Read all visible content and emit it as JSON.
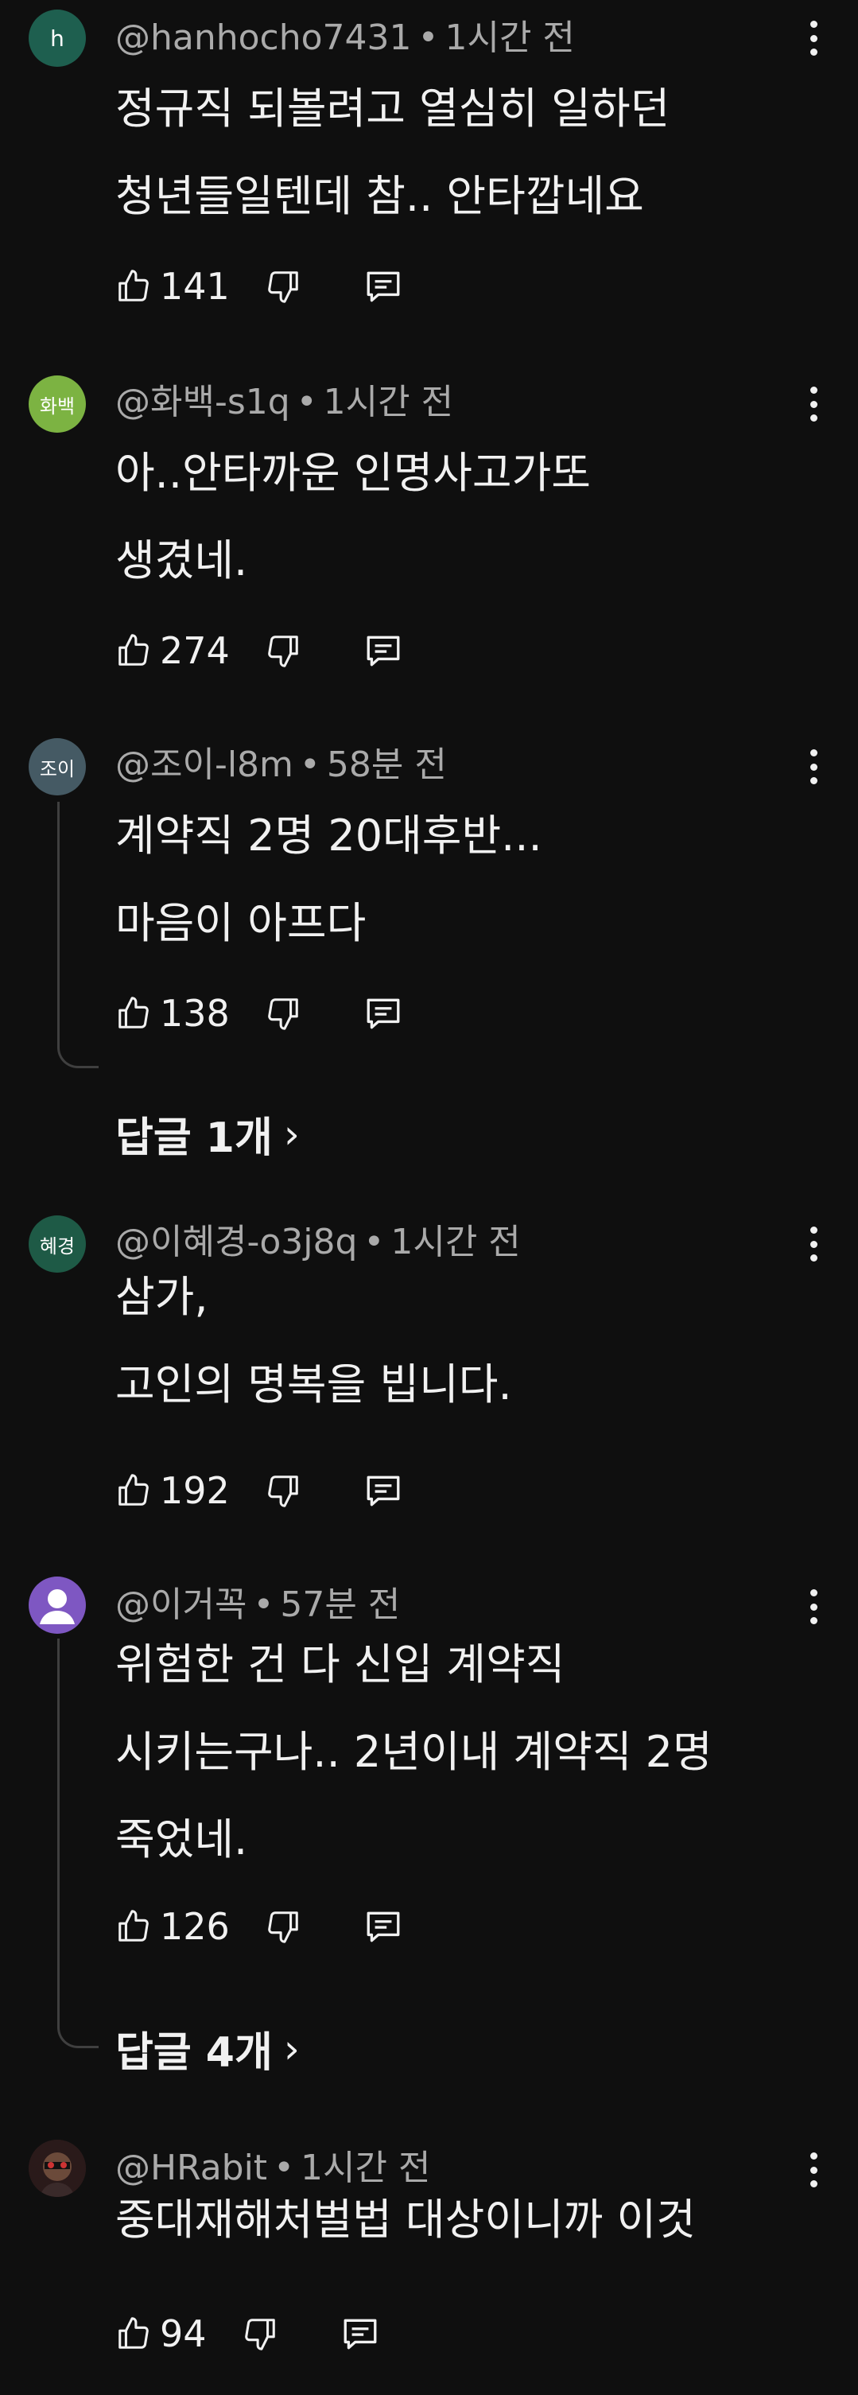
{
  "comments": [
    {
      "avatar_text": "h",
      "avatar_color": "#1e5f4f",
      "author": "@hanhocho7431",
      "time": "1시간 전",
      "text": "정규직 되볼려고 열심히 일하던\n청년들일텐데 참.. 안타깝네요",
      "likes": "141"
    },
    {
      "avatar_text": "화백",
      "avatar_color": "#7cb342",
      "author": "@화백-s1q",
      "time": "1시간 전",
      "text": "아..안타까운 인명사고가또\n생겼네.",
      "likes": "274"
    },
    {
      "avatar_text": "조이",
      "avatar_color": "#455a64",
      "author": "@조이-l8m",
      "time": "58분 전",
      "text": "계약직 2명 20대후반...\n마음이 아프다",
      "likes": "138",
      "replies": "답글 1개"
    },
    {
      "avatar_text": "혜경",
      "avatar_color": "#1e5a46",
      "author": "@이혜경-o3j8q",
      "time": "1시간 전",
      "text": "삼가,\n고인의 명복을 빕니다.",
      "likes": "192"
    },
    {
      "avatar_text": "",
      "avatar_color": "#7e57c2",
      "author": "@이거꼭",
      "time": "57분 전",
      "text": "위험한 건 다 신입 계약직\n시키는구나.. 2년이내 계약직 2명\n죽었네.",
      "likes": "126",
      "replies": "답글 4개"
    },
    {
      "avatar_text": "",
      "avatar_color": "#2a1a1a",
      "author": "@HRabit",
      "time": "1시간 전",
      "text": "중대재해처벌법 대상이니까 이것",
      "likes": "94"
    }
  ],
  "icons": {
    "like": "thumbs-up-icon",
    "dislike": "thumbs-down-icon",
    "reply": "comment-icon",
    "more": "kebab-menu-icon",
    "chevron": "›"
  },
  "colors": {
    "background": "#0f0f0f",
    "text": "#f1f1f1",
    "meta": "#aaaaaa"
  }
}
